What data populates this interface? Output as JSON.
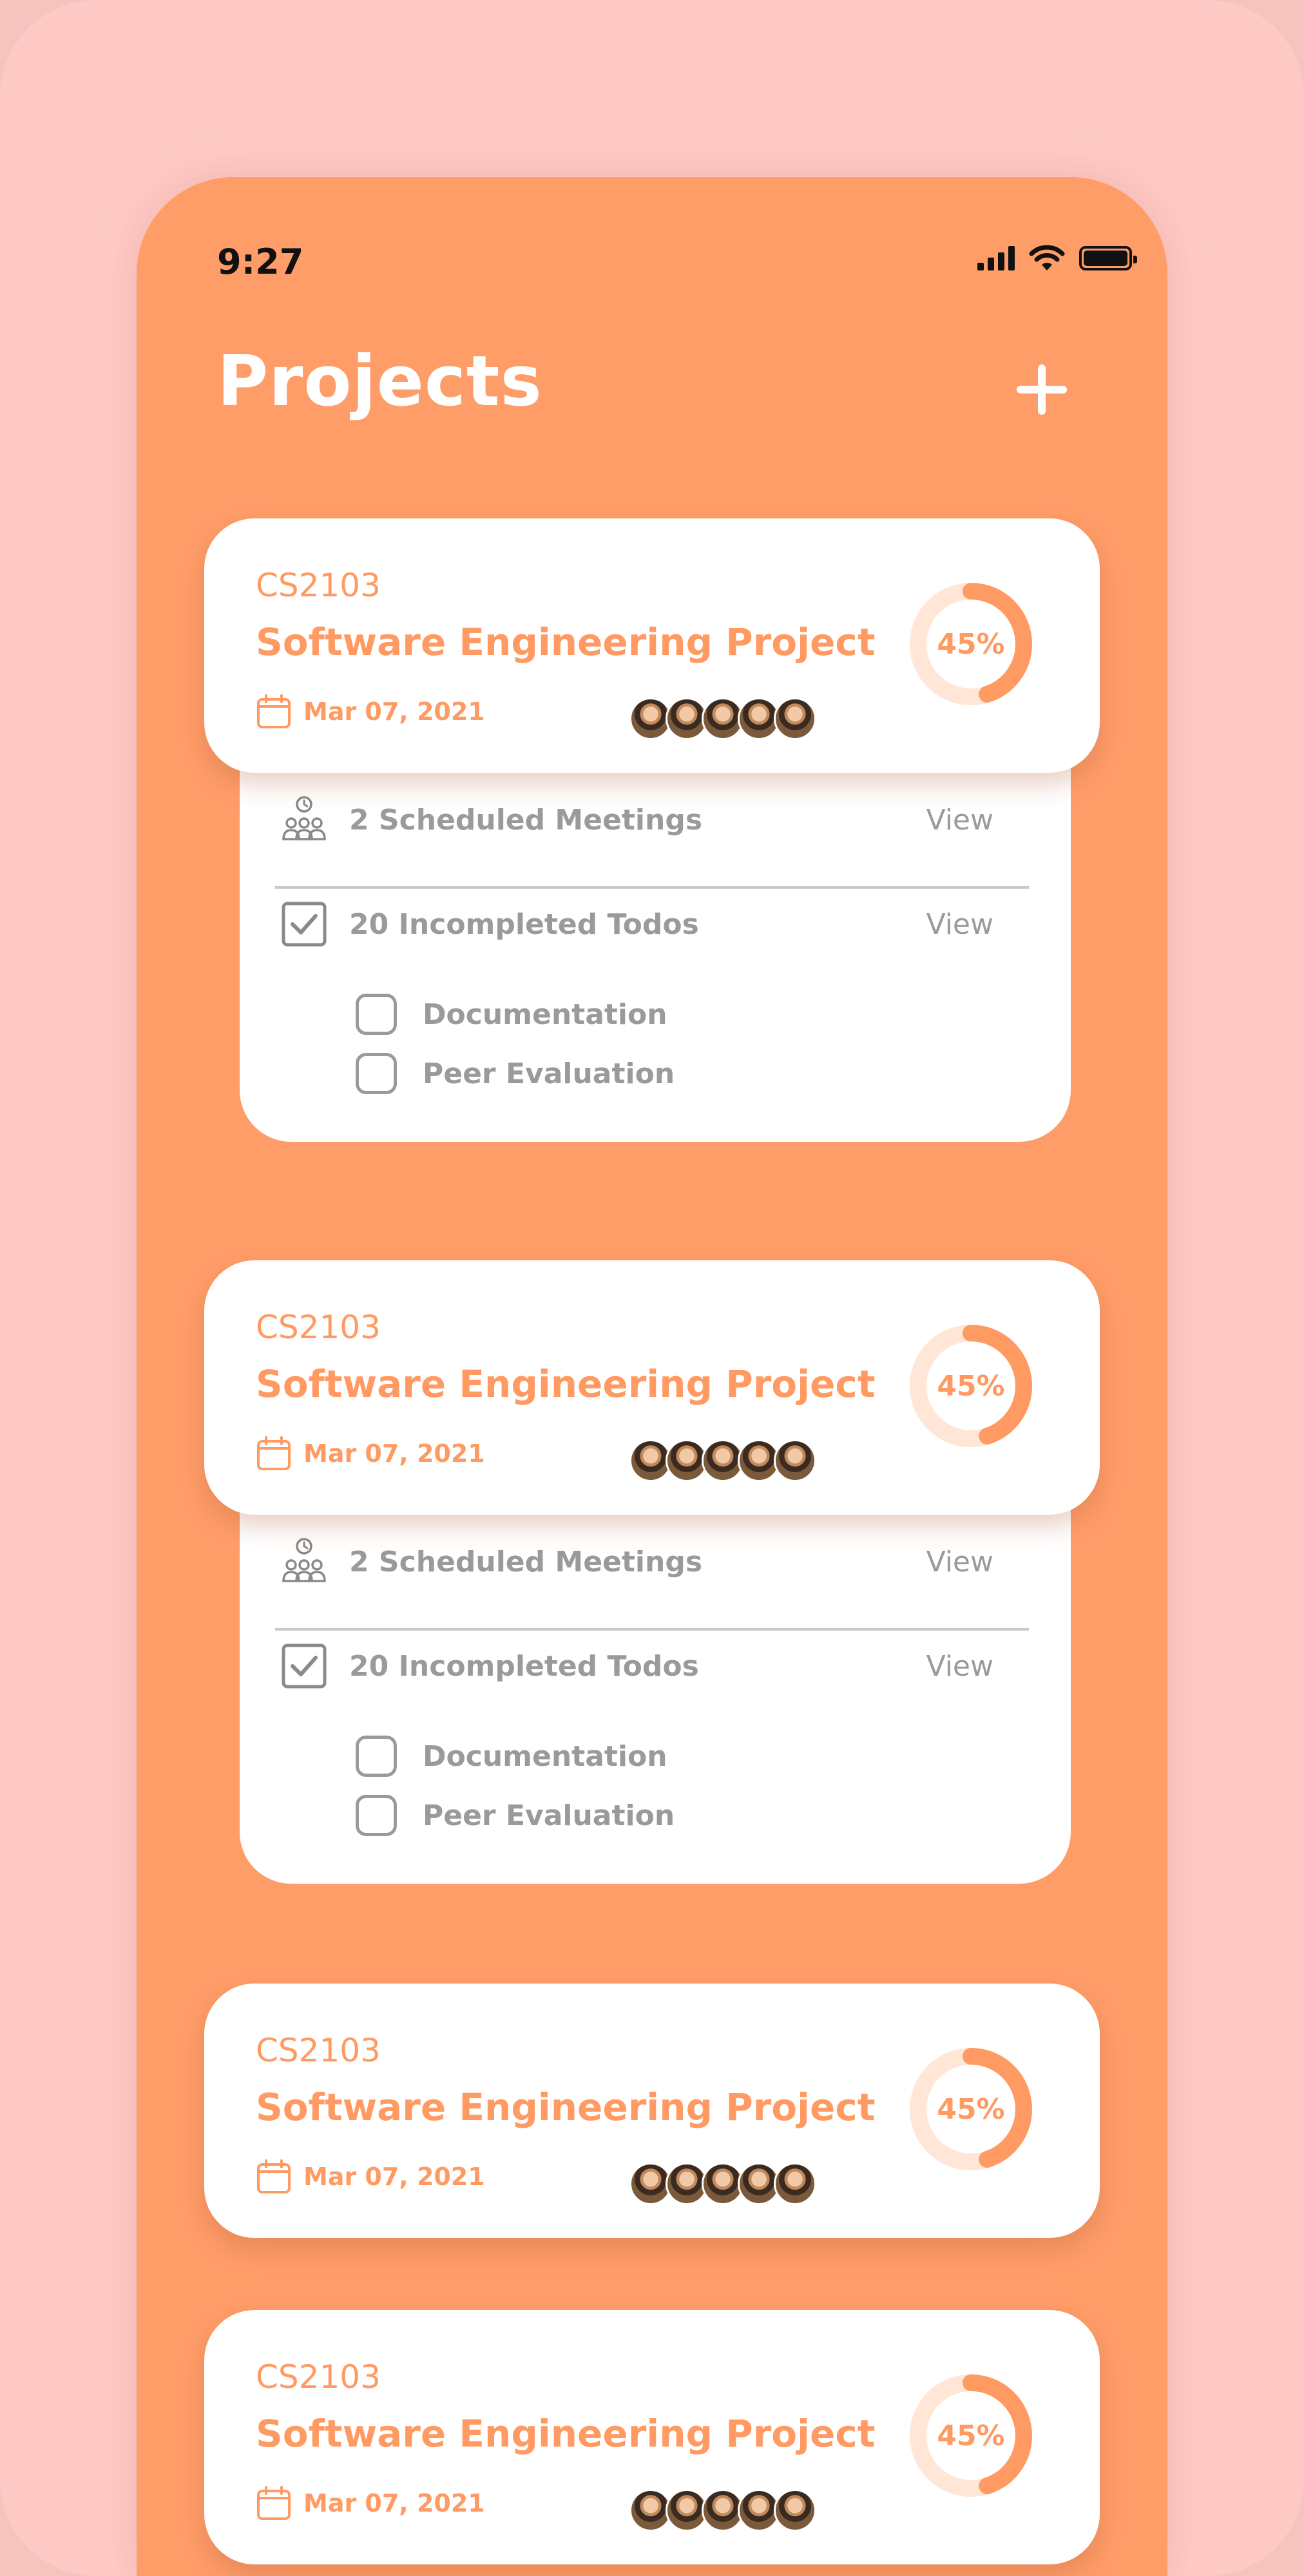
{
  "status_bar": {
    "time": "9:27"
  },
  "header": {
    "title": "Projects",
    "add_icon": "plus-icon"
  },
  "colors": {
    "accent": "#ff9a62",
    "phone_bg": "#ff9d69",
    "page_bg": "#ffcac6",
    "muted": "#9a9a9a",
    "progress_track": "#ffe6d6"
  },
  "projects": [
    {
      "course_code": "CS2103",
      "title": "Software Engineering Project",
      "date": "Mar 07, 2021",
      "progress_label": "45%",
      "progress": 0.45,
      "expanded": true,
      "meetings_text": "2 Scheduled Meetings",
      "meetings_view": "View",
      "todos_text": "20 Incompleted Todos",
      "todos_view": "View",
      "todo_items": [
        "Documentation",
        "Peer Evaluation"
      ]
    },
    {
      "course_code": "CS2103",
      "title": "Software Engineering Project",
      "date": "Mar 07, 2021",
      "progress_label": "45%",
      "progress": 0.45,
      "expanded": true,
      "meetings_text": "2 Scheduled Meetings",
      "meetings_view": "View",
      "todos_text": "20 Incompleted Todos",
      "todos_view": "View",
      "todo_items": [
        "Documentation",
        "Peer Evaluation"
      ]
    },
    {
      "course_code": "CS2103",
      "title": "Software Engineering Project",
      "date": "Mar 07, 2021",
      "progress_label": "45%",
      "progress": 0.45,
      "expanded": false
    },
    {
      "course_code": "CS2103",
      "title": "Software Engineering Project",
      "date": "Mar 07, 2021",
      "progress_label": "45%",
      "progress": 0.45,
      "expanded": false
    }
  ]
}
